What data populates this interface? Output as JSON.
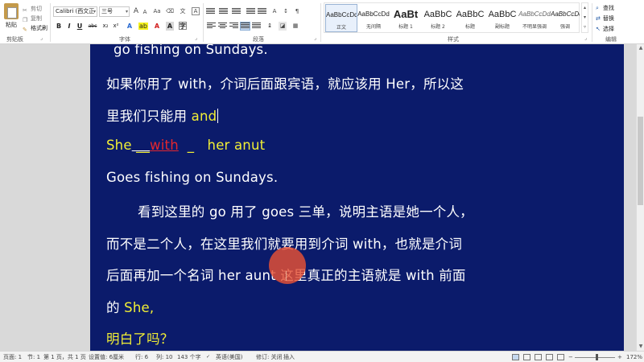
{
  "ribbon": {
    "clipboard": {
      "paste_label": "粘贴",
      "cut_label": "剪切",
      "copy_label": "复制",
      "format_painter_label": "格式刷",
      "group_label": "剪贴板"
    },
    "font": {
      "font_name": "Calibri (西文正",
      "font_size": "三号",
      "grow_label": "A",
      "shrink_label": "A",
      "bold_label": "B",
      "italic_label": "I",
      "underline_label": "U",
      "strike_label": "abc",
      "sub_label": "x₂",
      "sup_label": "x²",
      "group_label": "字体"
    },
    "paragraph": {
      "group_label": "段落"
    },
    "styles": {
      "group_label": "样式",
      "items": [
        {
          "sample": "AaBbCcDd",
          "name": "正文"
        },
        {
          "sample": "AaBbCcDd",
          "name": "无间隔"
        },
        {
          "sample": "AaBt",
          "name": "标题 1"
        },
        {
          "sample": "AaBbC",
          "name": "标题 2"
        },
        {
          "sample": "AaBbC",
          "name": "标题"
        },
        {
          "sample": "AaBbC",
          "name": "副标题"
        },
        {
          "sample": "AaBbCcDd",
          "name": "不明显强调"
        },
        {
          "sample": "AaBbCcDd",
          "name": "强调"
        }
      ]
    },
    "editing": {
      "find_label": "查找",
      "replace_label": "替换",
      "select_label": "选择",
      "group_label": "编辑"
    }
  },
  "document": {
    "line1": "go fishing on Sundays.",
    "line2": "如果你用了 with，介词后面跟宾语，就应该用 Her，所以这",
    "line3_prefix": "里我们只能用 ",
    "line3_highlight": "and",
    "line4_she": "She",
    "line4_blank_left": "  __",
    "line4_with": "with",
    "line4_blank_right": "_",
    "line4_rest": "her anut",
    "line5": "Goes fishing on Sundays.",
    "line6": "看到这里的 go 用了 goes 三单，说明主语是她一个人，",
    "line7": "而不是二个人，在这里我们就要用到介词 with，也就是介词",
    "line8": "后面再加一个名词 her aunt  这里真正的主语就是 with 前面",
    "line9_prefix": "的 ",
    "line9_highlight": "She,",
    "line10": "明白了吗？"
  },
  "statusbar": {
    "page": "页面: 1",
    "section": "节: 1",
    "page_of": "第 1 页，共 1 页",
    "position": "设置值: 6厘米",
    "line": "行: 6",
    "column": "列: 10",
    "words": "143 个字",
    "language": "英语(美国)",
    "revision": "修订: 关闭",
    "zoom": "172%"
  },
  "colors": {
    "page_background": "#0b1b6b",
    "highlight_text": "#f2ef35",
    "with_text": "#e5262d",
    "cursor_dot": "#e85234"
  }
}
